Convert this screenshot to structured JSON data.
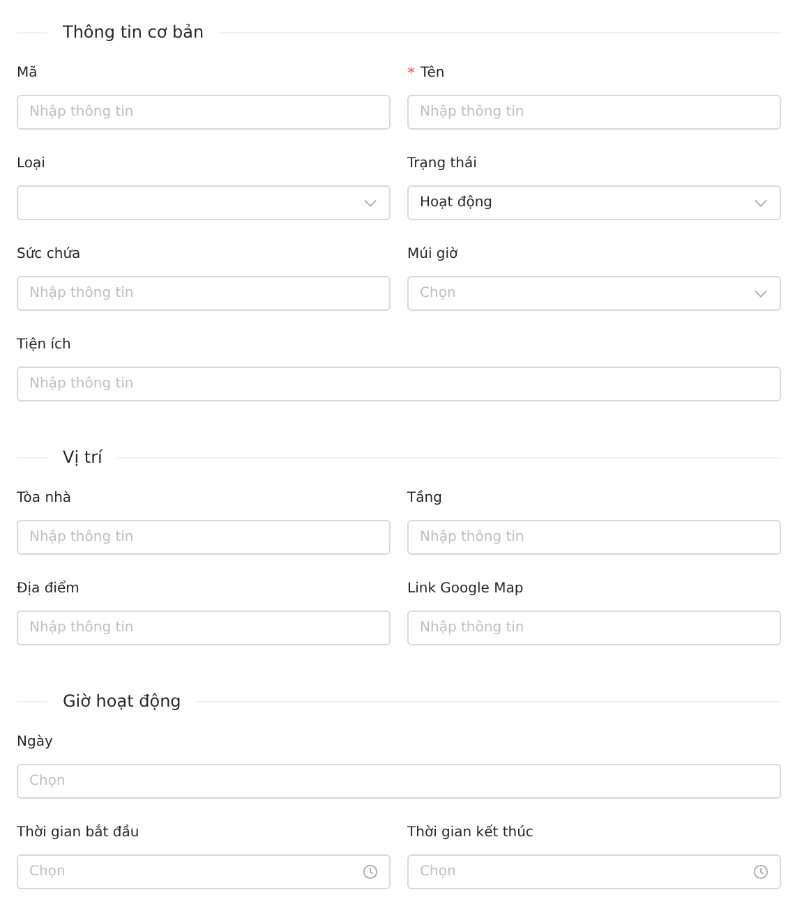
{
  "sections": [
    {
      "title": "Thông tin cơ bản",
      "fields": [
        {
          "kind": "text",
          "label": "Mã",
          "wide": false,
          "placeholder": "Nhập thông tin"
        },
        {
          "kind": "text",
          "label": "Tên",
          "required_mark": "*",
          "wide": false,
          "placeholder": "Nhập thông tin"
        },
        {
          "kind": "select",
          "label": "Loại",
          "wide": false
        },
        {
          "kind": "select",
          "label": "Trạng thái",
          "wide": false,
          "value": "Hoạt động"
        },
        {
          "kind": "text",
          "label": "Sức chứa",
          "wide": false,
          "placeholder": "Nhập thông tin"
        },
        {
          "kind": "select",
          "label": "Múi giờ",
          "wide": false,
          "placeholder": "Chọn"
        },
        {
          "kind": "text",
          "label": "Tiện ích",
          "wide": true,
          "placeholder": "Nhập thông tin"
        }
      ]
    },
    {
      "title": "Vị trí",
      "fields": [
        {
          "kind": "text",
          "label": "Tòa nhà",
          "wide": false,
          "placeholder": "Nhập thông tin"
        },
        {
          "kind": "text",
          "label": "Tầng",
          "wide": false,
          "placeholder": "Nhập thông tin"
        },
        {
          "kind": "text",
          "label": "Địa điểm",
          "wide": false,
          "placeholder": "Nhập thông tin"
        },
        {
          "kind": "text",
          "label": "Link Google Map",
          "wide": false,
          "placeholder": "Nhập thông tin"
        }
      ]
    },
    {
      "title": "Giờ hoạt động",
      "fields": [
        {
          "kind": "date",
          "label": "Ngày",
          "wide": true,
          "placeholder": "Chọn"
        },
        {
          "kind": "time",
          "label": "Thời gian bắt đầu",
          "wide": false,
          "placeholder": "Chọn"
        },
        {
          "kind": "time",
          "label": "Thời gian kết thúc",
          "wide": false,
          "placeholder": "Chọn"
        }
      ]
    }
  ]
}
